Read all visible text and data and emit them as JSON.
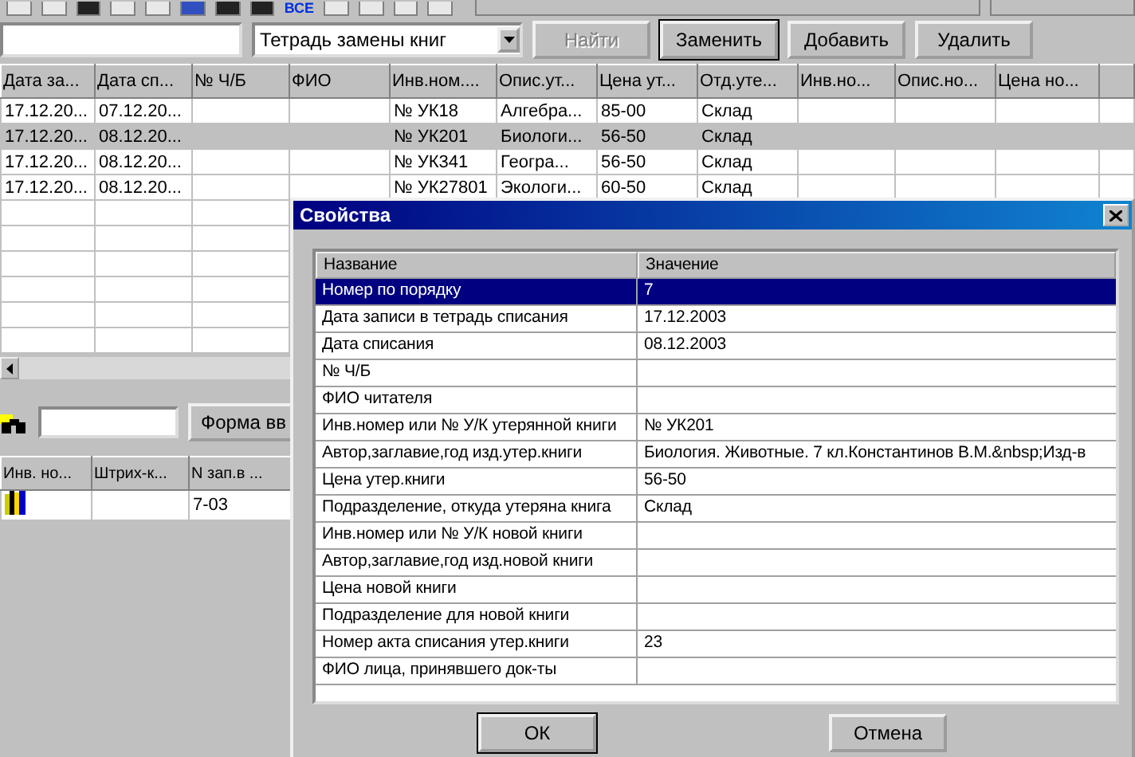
{
  "toolbar": {
    "all_label": "ВСЕ"
  },
  "filter": {
    "notebook": "Тетрадь замены книг",
    "buttons": [
      {
        "label": "Найти",
        "disabled": true
      },
      {
        "label": "Заменить",
        "disabled": false
      },
      {
        "label": "Добавить",
        "disabled": false
      },
      {
        "label": "Удалить",
        "disabled": false
      }
    ]
  },
  "table": {
    "columns": [
      "Дата за...",
      "Дата сп...",
      "№ Ч/Б",
      "ФИО",
      "Инв.ном....",
      "Опис.ут...",
      "Цена ут...",
      "Отд.уте...",
      "Инв.но...",
      "Опис.но...",
      "Цена но..."
    ],
    "rows": [
      {
        "selected": false,
        "cells": [
          "17.12.20...",
          "07.12.20...",
          null,
          null,
          "№ УК18",
          "Алгебра...",
          "85-00",
          "Склад",
          null,
          null,
          null
        ]
      },
      {
        "selected": true,
        "cells": [
          "17.12.20...",
          "08.12.20...",
          null,
          null,
          "№ УК201",
          "Биологи...",
          "56-50",
          "Склад",
          null,
          null,
          null
        ]
      },
      {
        "selected": false,
        "cells": [
          "17.12.20...",
          "08.12.20...",
          null,
          null,
          "№ УК341",
          "Геогра...",
          "56-50",
          "Склад",
          null,
          null,
          null
        ]
      },
      {
        "selected": false,
        "cells": [
          "17.12.20...",
          "08.12.20...",
          null,
          null,
          "№ УК27801",
          "Экологи...",
          "60-50",
          "Склад",
          null,
          null,
          null
        ]
      }
    ]
  },
  "lower_panel": {
    "button": "Форма вв",
    "columns": [
      "Инв. но...",
      "Штрих-к...",
      "N зап.в ..."
    ],
    "rows": [
      {
        "cells": [
          null,
          null,
          "7-03"
        ]
      }
    ]
  },
  "dialog": {
    "title": "Свойства",
    "columns": [
      "Название",
      "Значение"
    ],
    "properties": [
      {
        "name": "Номер по порядку",
        "value": "7",
        "selected": true
      },
      {
        "name": "Дата записи в тетрадь списания",
        "value": "17.12.2003",
        "selected": false
      },
      {
        "name": "Дата списания",
        "value": "08.12.2003",
        "selected": false
      },
      {
        "name": "№ Ч/Б",
        "selected": false
      },
      {
        "name": "ФИО читателя",
        "selected": false
      },
      {
        "name": "Инв.номер или № У/К утерянной книги",
        "value": "№ УК201",
        "selected": false
      },
      {
        "name": "Автор,заглавие,год изд.утер.книги",
        "value": "Биология. Животные. 7 кл.Константинов В.М.&nbsp;Изд-в",
        "selected": false
      },
      {
        "name": "Цена утер.книги",
        "value": "56-50",
        "selected": false
      },
      {
        "name": "Подразделение, откуда утеряна книга",
        "value": "Склад",
        "selected": false
      },
      {
        "name": "Инв.номер или № У/К новой книги",
        "selected": false
      },
      {
        "name": "Автор,заглавие,год изд.новой книги",
        "selected": false
      },
      {
        "name": "Цена новой книги",
        "selected": false
      },
      {
        "name": "Подразделение для новой книги",
        "selected": false
      },
      {
        "name": "Номер акта списания утер.книги",
        "value": "23",
        "selected": false
      },
      {
        "name": "ФИО лица, принявшего док-ты",
        "selected": false
      }
    ],
    "buttons": [
      "ОК",
      "Отмена"
    ]
  }
}
